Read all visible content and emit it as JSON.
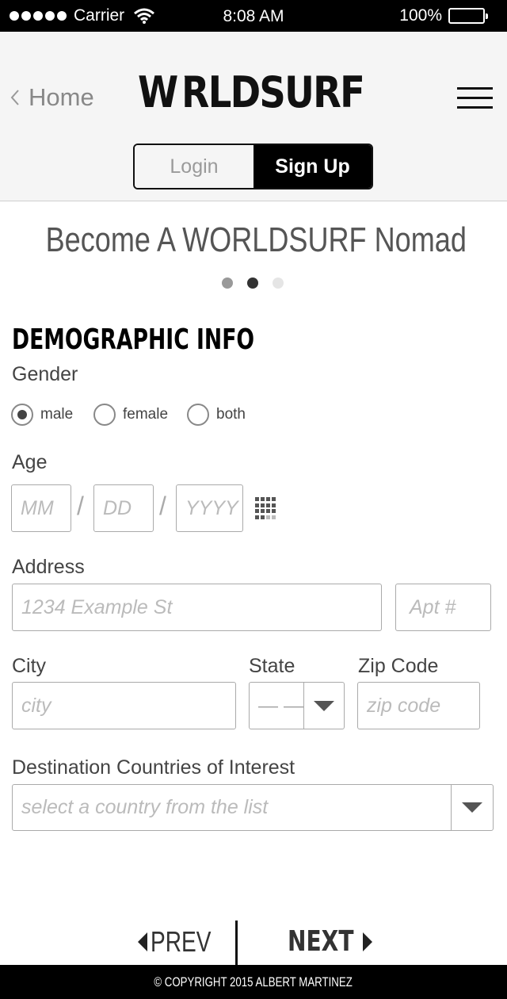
{
  "status_bar": {
    "carrier": "Carrier",
    "time": "8:08 AM",
    "battery": "100%"
  },
  "header": {
    "back_label": "Home",
    "logo_text_before": "W",
    "logo_text_after": "RLDSURF",
    "tabs": {
      "login": "Login",
      "signup": "Sign Up"
    }
  },
  "page": {
    "heading": "Become A WORLDSURF Nomad",
    "section_title": "DEMOGRAPHIC INFO"
  },
  "progress": {
    "current_step": 2,
    "total_steps": 3
  },
  "form": {
    "gender": {
      "label": "Gender",
      "options": [
        "male",
        "female",
        "both"
      ],
      "selected": "male"
    },
    "age": {
      "label": "Age",
      "month_placeholder": "MM",
      "day_placeholder": "DD",
      "year_placeholder": "YYYY",
      "separator": "/"
    },
    "address": {
      "label": "Address",
      "street_placeholder": "1234 Example St",
      "apt_placeholder": "Apt #"
    },
    "city": {
      "label": "City",
      "placeholder": "city"
    },
    "state": {
      "label": "State",
      "value": "— —"
    },
    "zip": {
      "label": "Zip Code",
      "placeholder": "zip code"
    },
    "countries": {
      "label": "Destination Countries of Interest",
      "placeholder": "select a country from the list"
    }
  },
  "nav": {
    "prev": "PREV",
    "next": "NEXT"
  },
  "footer": {
    "copyright": "© COPYRIGHT 2015 ALBERT MARTINEZ"
  },
  "colors": {
    "brand": "#000000",
    "header_bg": "#f5f5f5",
    "muted_text": "#888888",
    "dot_active": "#333333",
    "dot_done": "#999999",
    "dot_pending": "#e5e5e5"
  }
}
